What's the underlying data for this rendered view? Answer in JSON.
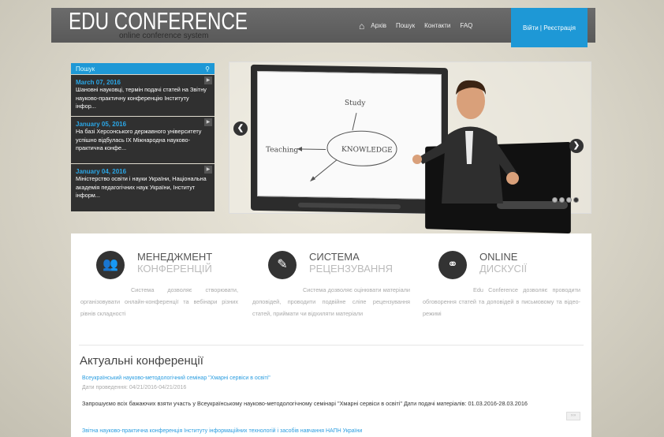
{
  "header": {
    "logo_main": "EDU CONFERENCE",
    "logo_sub": "online conference system",
    "nav": [
      "Архів",
      "Пошук",
      "Контакти",
      "FAQ"
    ],
    "login": "Війти | Реєстрація"
  },
  "news": {
    "search_label": "Пошук",
    "items": [
      {
        "date": "March 07, 2016",
        "text": "Шановні науковці, термін подачі статей на Звітну науково-практичну конференцію Інституту інфор..."
      },
      {
        "date": "January 05, 2016",
        "text": "На базі Херсонського державного університету успішно відбулась IX Міжнародна науково-практична конфе..."
      },
      {
        "date": "January 04, 2016",
        "text": "Міністерство освіти і науки України, Національна академія педагогічних наук України, Інститут інформ..."
      }
    ]
  },
  "slider": {
    "board_words": [
      "Teaching",
      "KNOWLEDGE",
      "Study"
    ],
    "dots": 4,
    "active_dot": 3
  },
  "features": [
    {
      "title1": "МЕНЕДЖМЕНТ",
      "title2": "КОНФЕРЕНЦІЙ",
      "desc": "Система дозволяє створювати, організовувати онлайн-конференції та вебінари різних рівнів складності"
    },
    {
      "title1": "СИСТЕМА",
      "title2": "РЕЦЕНЗУВАННЯ",
      "desc": "Система дозволяє оцінювати матеріали доповідей, проводити подвійне сліпе рецензування статей, приймати чи відхиляти матеріали"
    },
    {
      "title1": "ONLINE",
      "title2": "ДИСКУСІЇ",
      "desc": "Edu Conference дозволяє проводити обговорення статей та доповідей в письмовому та відео-режимі"
    }
  ],
  "conferences": {
    "title": "Актуальні конференції",
    "items": [
      {
        "link": "Всеукраїнський науково-методологічний семінар \"Хмарні сервіси в освіті\"",
        "dates": "Дати проведення: 04/21/2016-04/21/2016",
        "desc": "Запрошуємо всіх бажаючих взяти участь у Всеукраїнському науково-методологічному семінарі \"Хмарні сервіси в освіті\"  Дати подачі матеріалів: 01.03.2016-28.03.2016"
      },
      {
        "link": "Звітна науково-практична конференція Інституту інформаційних технологій і засобів навчання НАПН України"
      }
    ],
    "more": "»»"
  }
}
